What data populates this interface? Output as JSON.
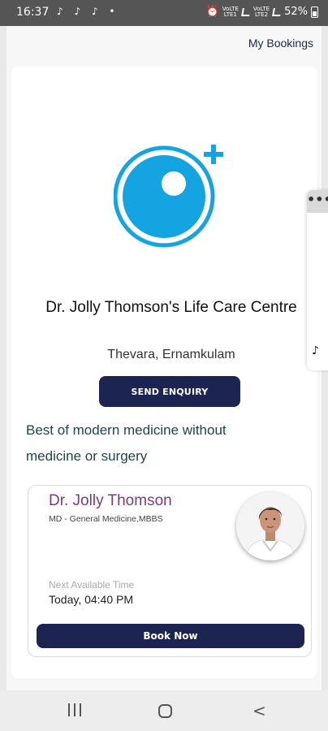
{
  "status_bar": {
    "time": "16:37",
    "notification_icons": "♪ ♪ ♪ •",
    "net1_top": "VoLTE",
    "net1_bottom": "LTE1",
    "net2_top": "VoLTE",
    "net2_bottom": "LTE2",
    "battery": "52%"
  },
  "header": {
    "my_bookings": "My Bookings"
  },
  "clinic": {
    "name": "Dr. Jolly Thomson's Life Care Centre",
    "location": "Thevara, Ernamkulam",
    "enquiry_button": "SEND ENQUIRY",
    "tagline": "Best of modern medicine without medicine or surgery",
    "logo_icon": "lens-plus-logo-icon",
    "accent_color": "#14a4e2"
  },
  "doctor": {
    "name": "Dr. Jolly Thomson",
    "qualification": "MD - General Medicine,MBBS",
    "next_label": "Next Available Time",
    "next_time": "Today, 04:40 PM",
    "book_button": "Book Now",
    "name_color": "#7a3a82"
  },
  "side_widget": {
    "menu": "•••",
    "music": "♪"
  },
  "nav": {
    "back": "<"
  },
  "colors": {
    "primary_button": "#1c2452",
    "tagline": "#204646"
  }
}
